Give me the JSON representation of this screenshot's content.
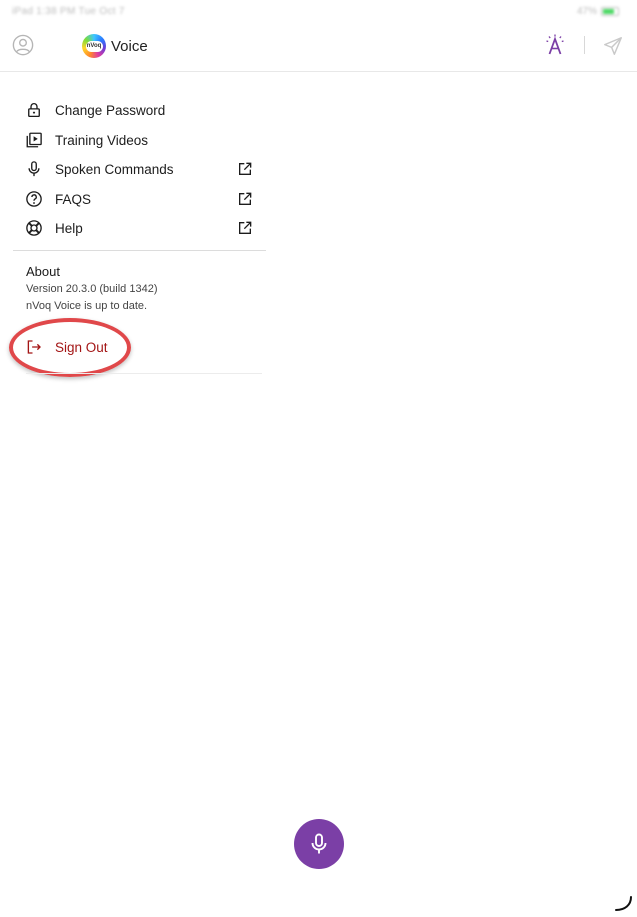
{
  "status_bar": {
    "left_text": "iPad  1:38 PM  Tue Oct 7",
    "right_text": "47%"
  },
  "header": {
    "brand_logo_text": "nVoq",
    "brand_name": "Voice"
  },
  "menu": {
    "items": [
      {
        "label": "Change Password",
        "icon": "lock-icon",
        "external": false
      },
      {
        "label": "Training Videos",
        "icon": "video-library-icon",
        "external": false
      },
      {
        "label": "Spoken Commands",
        "icon": "microphone-icon",
        "external": true
      },
      {
        "label": "FAQS",
        "icon": "question-circle-icon",
        "external": true
      },
      {
        "label": "Help",
        "icon": "lifebuoy-icon",
        "external": true
      }
    ]
  },
  "about": {
    "title": "About",
    "version": "Version 20.3.0 (build 1342)",
    "status": "nVoq Voice is up to date."
  },
  "sign_out": {
    "label": "Sign Out",
    "icon": "sign-out-icon"
  },
  "colors": {
    "accent": "#7b3fa6",
    "sign_out": "#a31515",
    "highlight": "#e0484a"
  }
}
